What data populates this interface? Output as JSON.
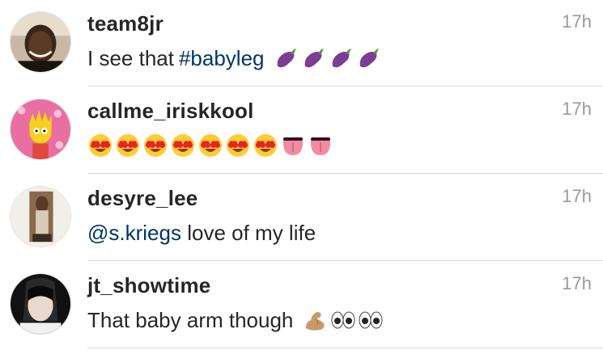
{
  "comments": [
    {
      "username": "team8jr",
      "time": "17h",
      "avatar": "profile-photo",
      "text_plain": "I see that ",
      "link": "#babyleg",
      "text_after": "",
      "emojis": [
        "eggplant",
        "eggplant",
        "eggplant",
        "eggplant"
      ]
    },
    {
      "username": "callme_iriskkool",
      "time": "17h",
      "avatar": "cartoon-avatar",
      "text_plain": "",
      "link": "",
      "text_after": "",
      "emojis": [
        "heart-eyes",
        "heart-eyes",
        "heart-eyes",
        "heart-eyes",
        "heart-eyes",
        "heart-eyes",
        "heart-eyes",
        "tongue",
        "tongue"
      ]
    },
    {
      "username": "desyre_lee",
      "time": "17h",
      "avatar": "profile-photo",
      "text_plain": "",
      "link": "@s.kriegs",
      "text_after": " love of my life",
      "emojis": []
    },
    {
      "username": "jt_showtime",
      "time": "17h",
      "avatar": "profile-photo",
      "text_plain": "That baby arm though",
      "link": "",
      "text_after": "",
      "emojis": [
        "flexed-biceps",
        "eyes",
        "eyes"
      ]
    }
  ],
  "colors": {
    "link": "#003569",
    "username": "#262626",
    "time": "#999999",
    "divider": "#dbdbdb"
  }
}
